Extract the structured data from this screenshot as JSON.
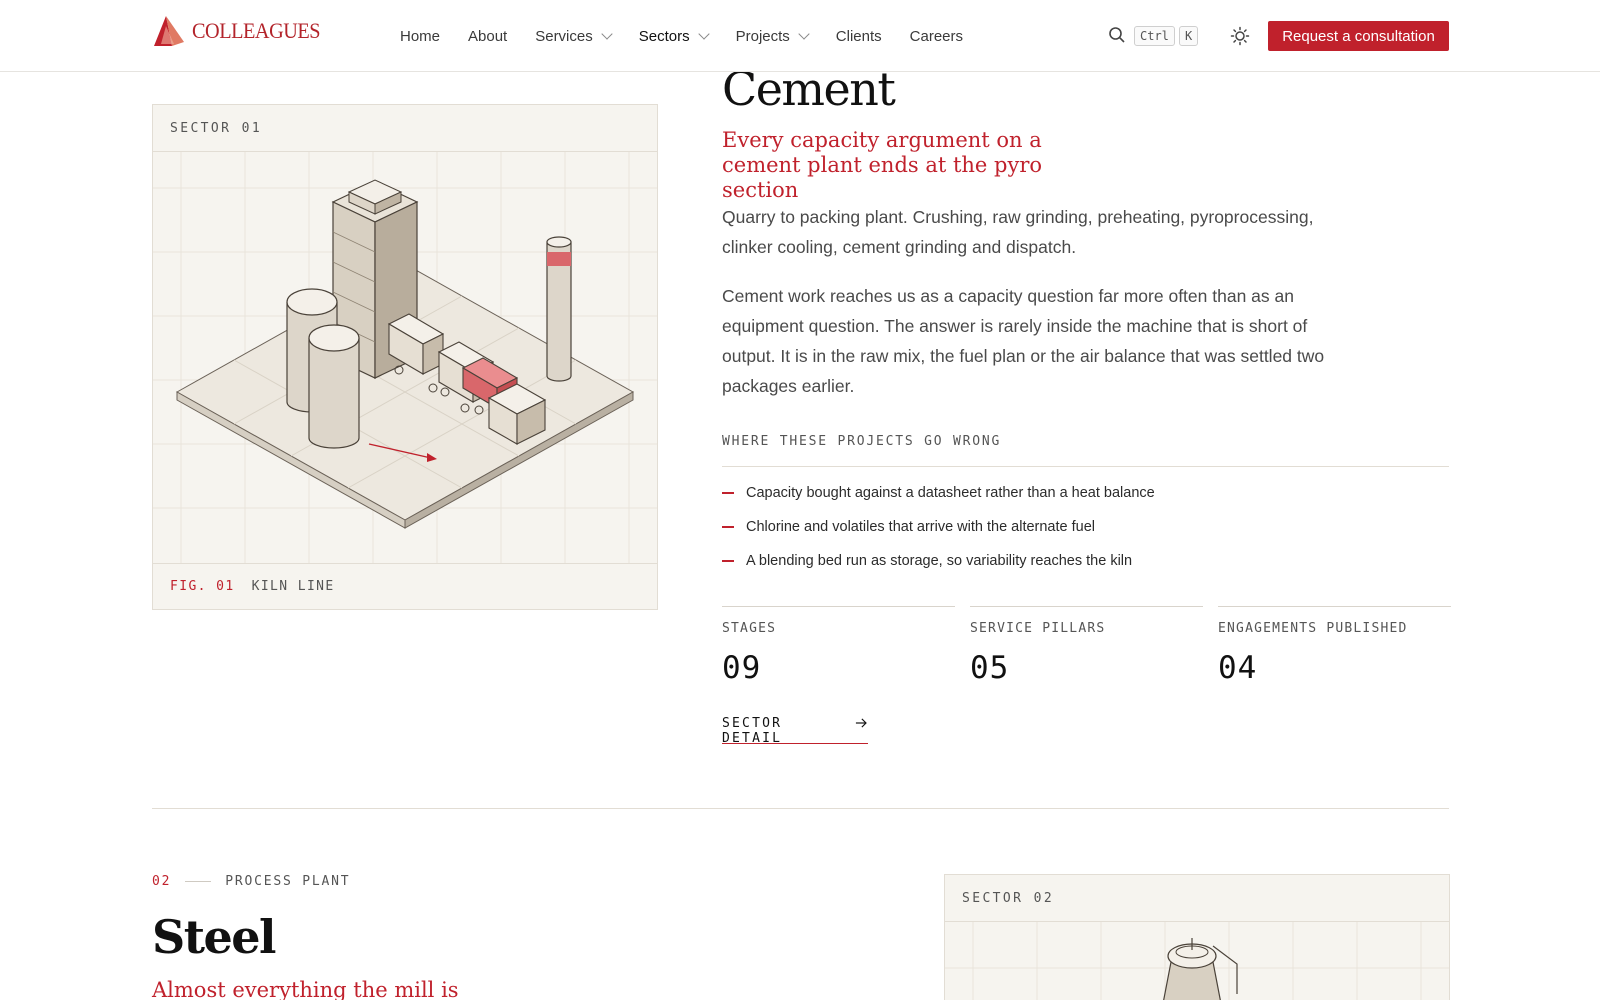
{
  "brand": {
    "name": "COLLEAGUES"
  },
  "nav": {
    "items": [
      {
        "label": "Home",
        "dropdown": false
      },
      {
        "label": "About",
        "dropdown": false
      },
      {
        "label": "Services",
        "dropdown": true
      },
      {
        "label": "Sectors",
        "dropdown": true,
        "active": true
      },
      {
        "label": "Projects",
        "dropdown": true
      },
      {
        "label": "Clients",
        "dropdown": false
      },
      {
        "label": "Careers",
        "dropdown": false
      }
    ],
    "search_shortcut": [
      "Ctrl",
      "K"
    ],
    "cta_label": "Request a consultation"
  },
  "sector1": {
    "figure_label": "SECTOR 01",
    "fig_number": "FIG. 01",
    "fig_caption": "KILN LINE",
    "title": "Cement",
    "lede": "Every capacity argument on a cement plant ends at the pyro section",
    "paragraph1": "Quarry to packing plant. Crushing, raw grinding, preheating, pyroprocessing, clinker cooling, cement grinding and dispatch.",
    "paragraph2": "Cement work reaches us as a capacity question far more often than as an equipment question. The answer is rarely inside the machine that is short of output. It is in the raw mix, the fuel plan or the air balance that was settled two packages earlier.",
    "issues_heading": "WHERE THESE PROJECTS GO WRONG",
    "issues": [
      "Capacity bought against a datasheet rather than a heat balance",
      "Chlorine and volatiles that arrive with the alternate fuel",
      "A blending bed run as storage, so variability reaches the kiln"
    ],
    "stats": [
      {
        "label": "STAGES",
        "value": "09"
      },
      {
        "label": "SERVICE PILLARS",
        "value": "05"
      },
      {
        "label": "ENGAGEMENTS PUBLISHED",
        "value": "04"
      }
    ],
    "detail_link": "SECTOR DETAIL"
  },
  "sector2": {
    "number": "02",
    "category": "PROCESS PLANT",
    "title": "Steel",
    "lede": "Almost everything the mill is",
    "figure_label": "SECTOR 02"
  },
  "colors": {
    "accent": "#c0212c",
    "card_bg": "#f6f4ef",
    "text": "#2b2b2b"
  }
}
